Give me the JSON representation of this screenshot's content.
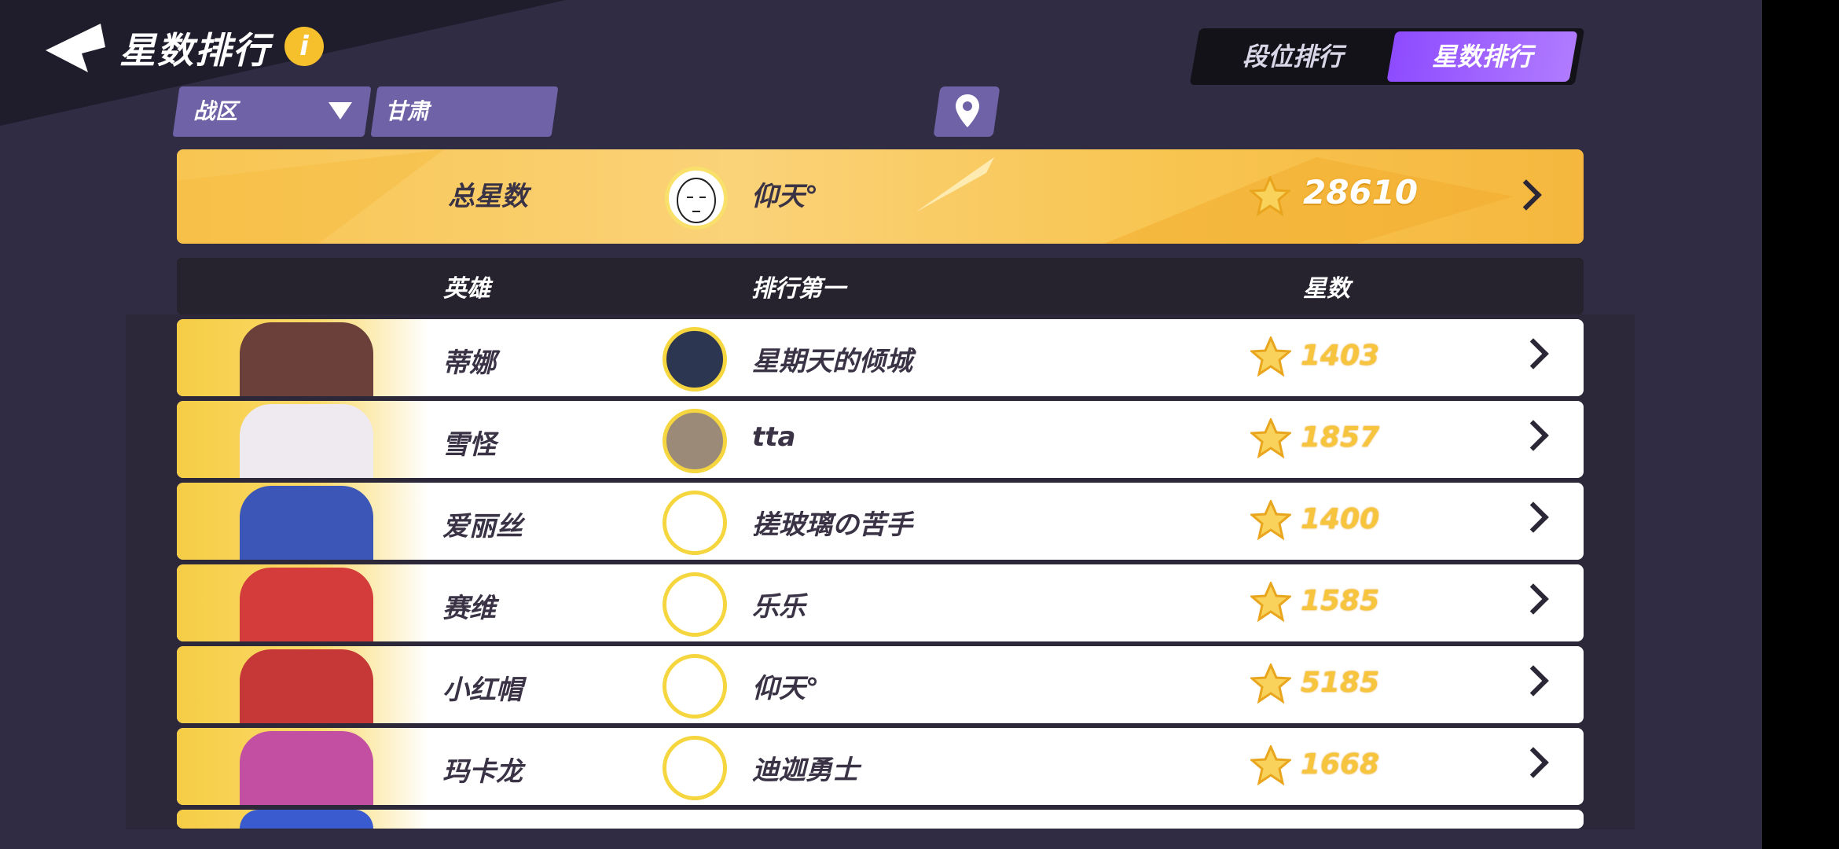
{
  "header": {
    "title": "星数排行",
    "info_icon": "i"
  },
  "tabs": [
    {
      "label": "段位排行",
      "active": false
    },
    {
      "label": "星数排行",
      "active": true
    }
  ],
  "filters": {
    "region_label": "战区",
    "province": "甘肃"
  },
  "total": {
    "label": "总星数",
    "player": "仰天°",
    "stars": "28610"
  },
  "columns": {
    "hero": "英雄",
    "top": "排行第一",
    "stars": "星数"
  },
  "rows": [
    {
      "hero": "蒂娜",
      "player": "星期天的倾城",
      "stars": "1403",
      "portrait_color": "#6b3f3a",
      "avatar_color": "#2d3650"
    },
    {
      "hero": "雪怪",
      "player": "tta",
      "stars": "1857",
      "portrait_color": "#efe9f0",
      "avatar_color": "#9c8a78"
    },
    {
      "hero": "爱丽丝",
      "player": "搓玻璃の苦手",
      "stars": "1400",
      "portrait_color": "#3c56b8",
      "avatar_color": "#ffffff"
    },
    {
      "hero": "赛维",
      "player": "乐乐",
      "stars": "1585",
      "portrait_color": "#d43c3c",
      "avatar_color": "#ffffff"
    },
    {
      "hero": "小红帽",
      "player": "仰天°",
      "stars": "5185",
      "portrait_color": "#c63838",
      "avatar_color": "#ffffff"
    },
    {
      "hero": "玛卡龙",
      "player": "迪迦勇士",
      "stars": "1668",
      "portrait_color": "#c24fa2",
      "avatar_color": "#ffffff"
    }
  ]
}
